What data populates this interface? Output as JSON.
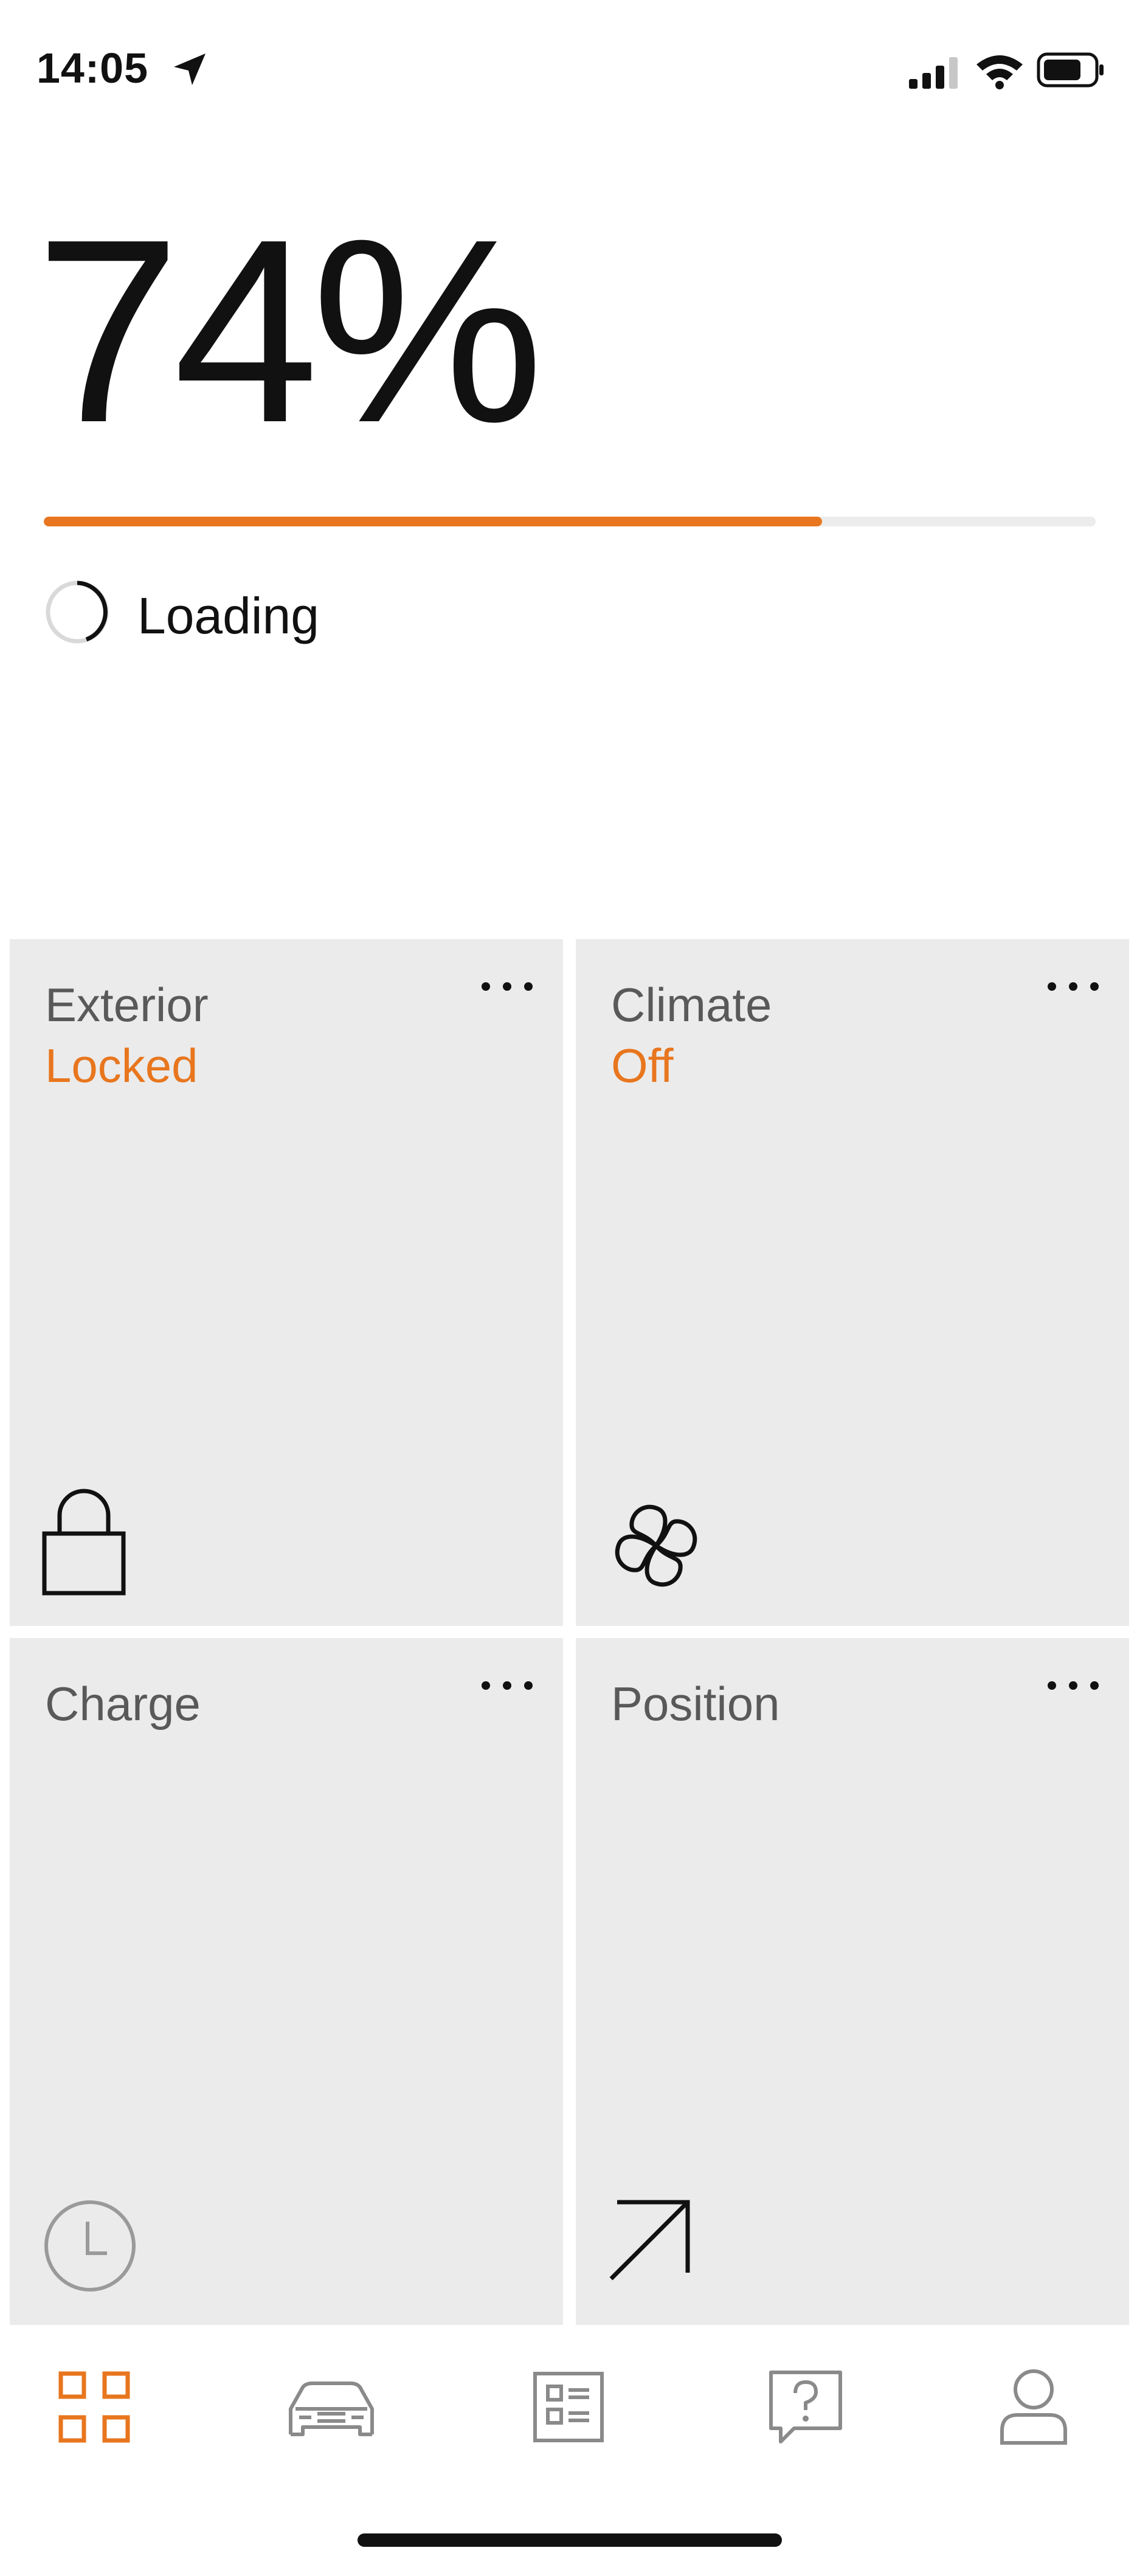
{
  "status_bar": {
    "time": "14:05",
    "icons": [
      "location-arrow-icon",
      "cellular-signal-icon",
      "wifi-icon",
      "battery-icon"
    ]
  },
  "battery": {
    "percent_text": "74%",
    "charge_fraction": 0.74,
    "loading_text": "Loading"
  },
  "tiles": [
    {
      "title": "Exterior",
      "status": "Locked",
      "icon": "lock-icon"
    },
    {
      "title": "Climate",
      "status": "Off",
      "icon": "fan-icon"
    },
    {
      "title": "Charge",
      "status": "",
      "icon": "clock-icon"
    },
    {
      "title": "Position",
      "status": "",
      "icon": "arrow-up-right-icon"
    }
  ],
  "nav": [
    {
      "name": "overview",
      "icon": "grid-icon",
      "active": true
    },
    {
      "name": "vehicle",
      "icon": "car-icon",
      "active": false
    },
    {
      "name": "list",
      "icon": "list-icon",
      "active": false
    },
    {
      "name": "help",
      "icon": "help-icon",
      "active": false
    },
    {
      "name": "profile",
      "icon": "profile-icon",
      "active": false
    }
  ],
  "colors": {
    "accent": "#e8761e",
    "tile_bg": "#ebebeb",
    "icon": "#111111",
    "inactive_icon": "#8a8a8a"
  }
}
